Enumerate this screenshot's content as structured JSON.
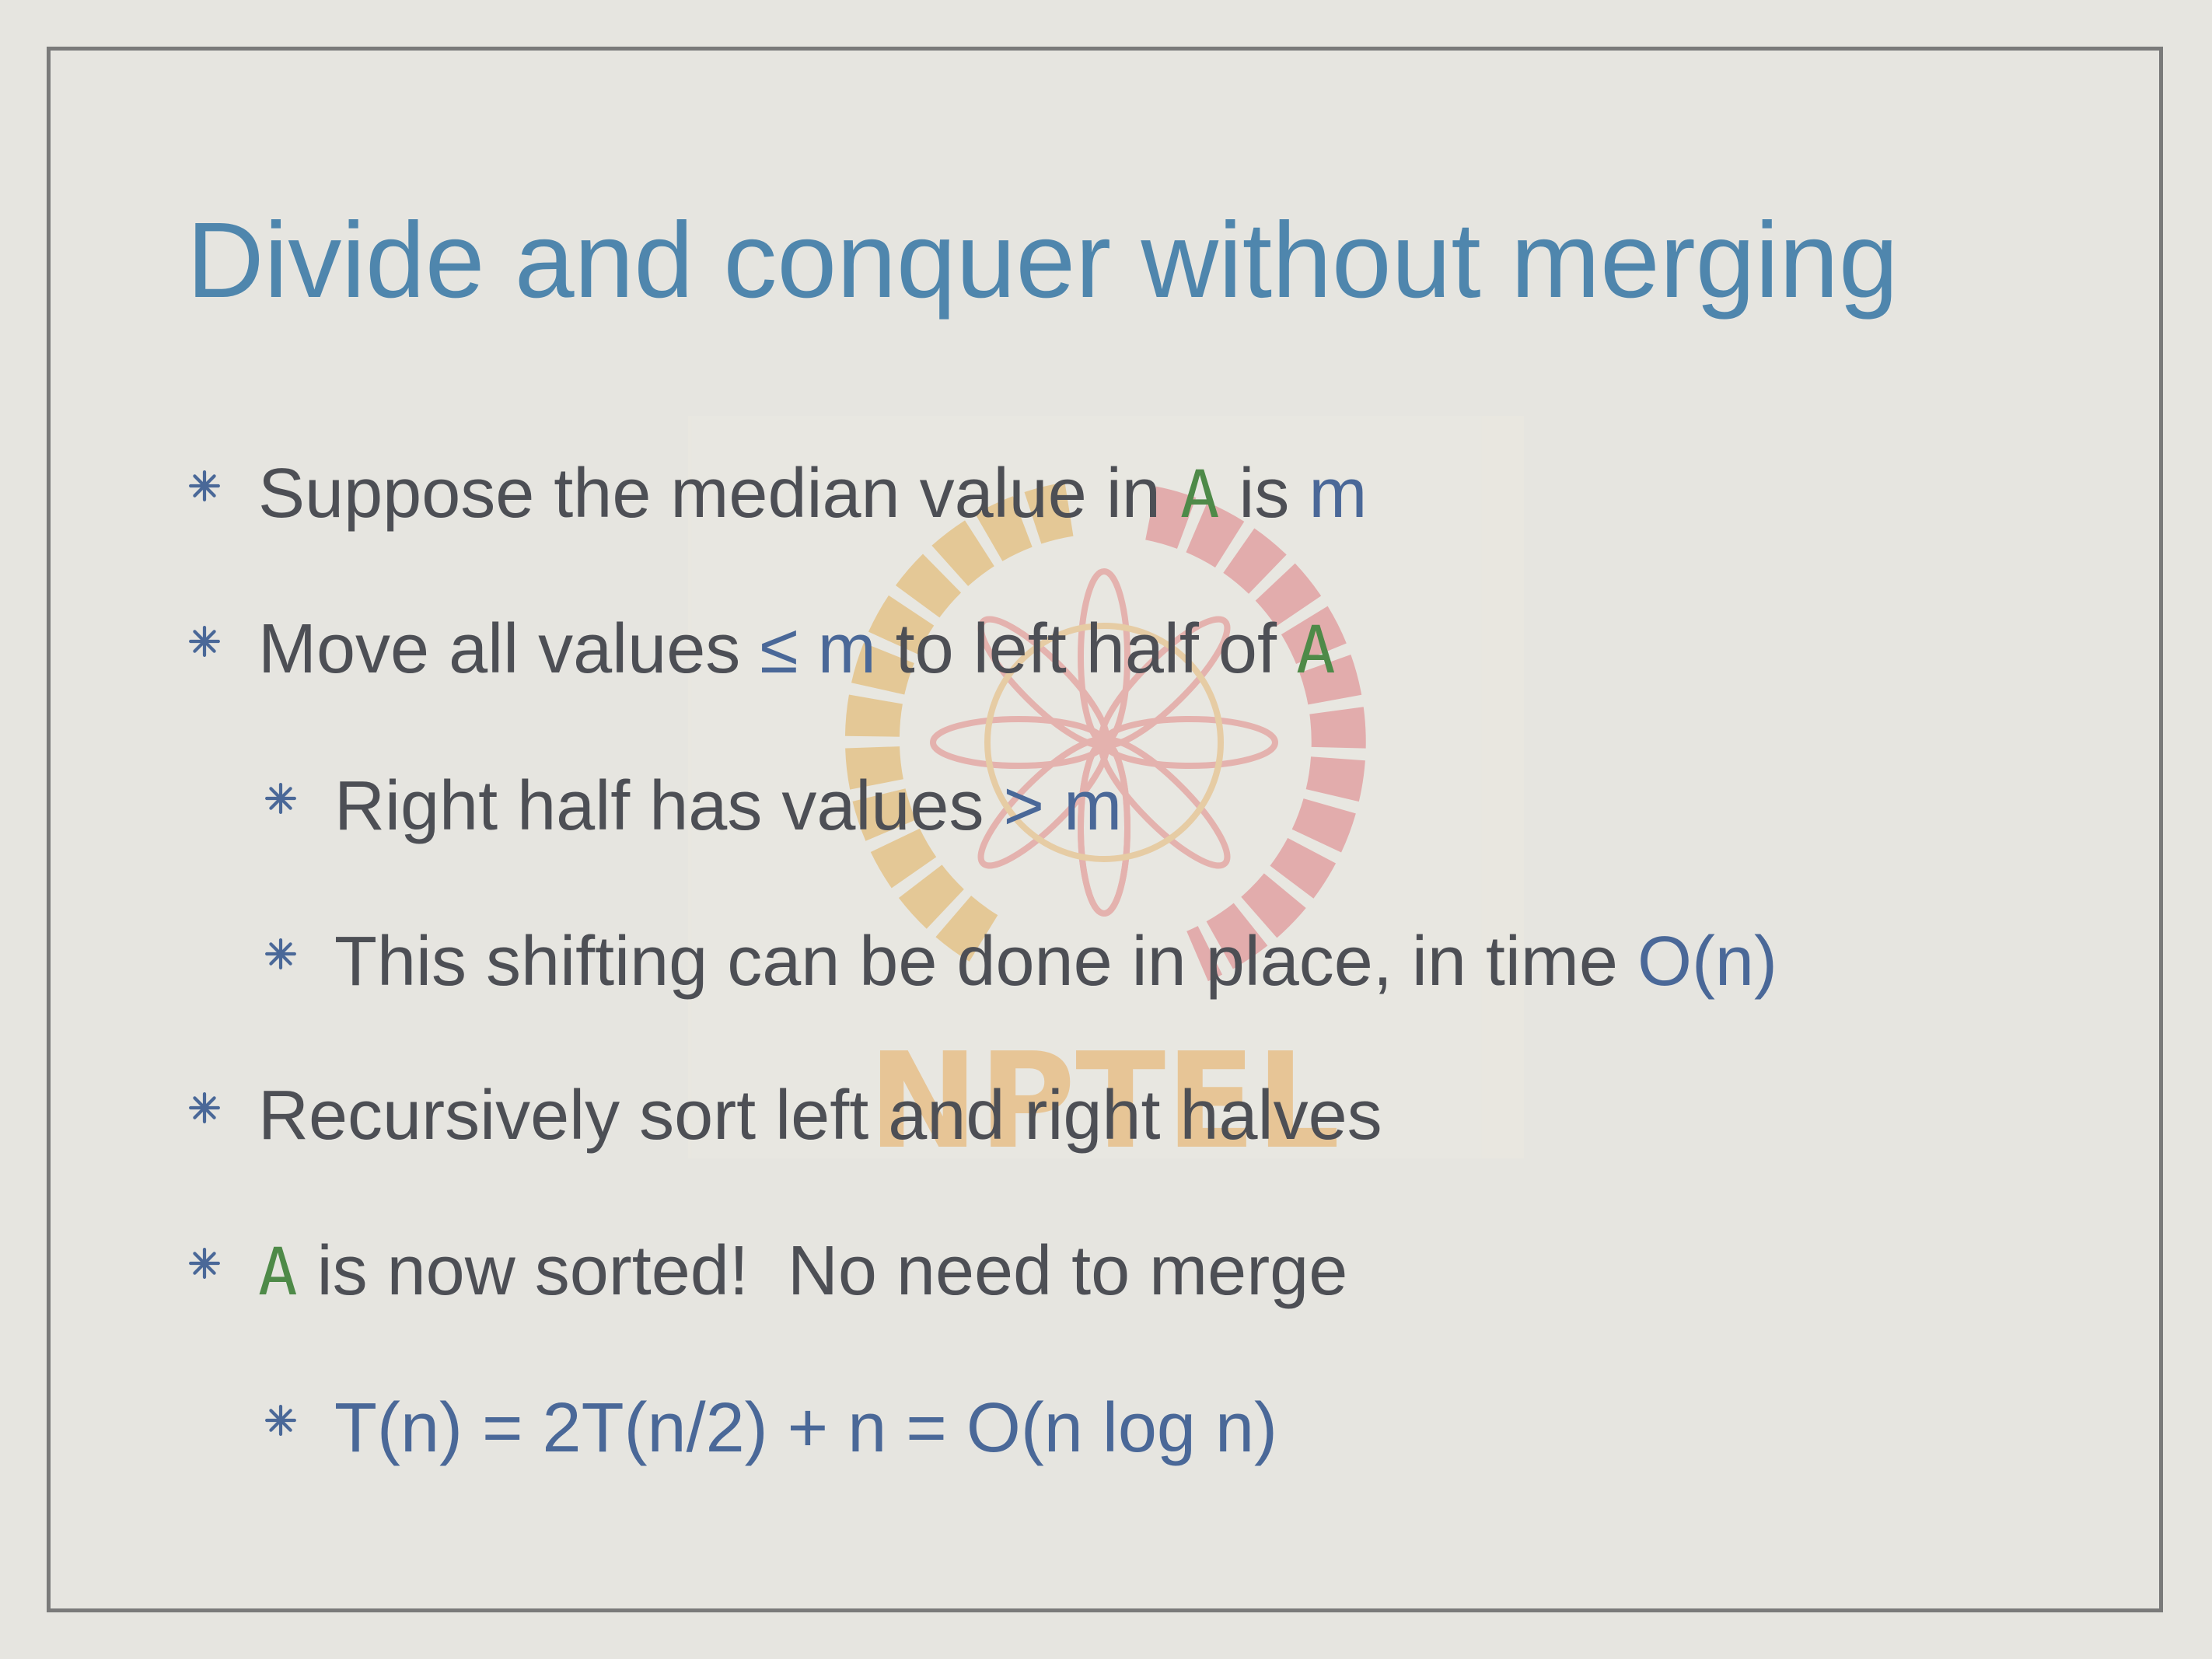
{
  "slide": {
    "title": "Divide and conquer without merging",
    "watermark_text": "NPTEL",
    "bullet_icon": "asterisk-bullet-icon",
    "colors": {
      "title": "#4f86ad",
      "body_text": "#4d4f55",
      "array_name": "#4e8a48",
      "math": "#4a6898",
      "frame": "#7a7a7a",
      "background": "#e6e5e0"
    },
    "bullets": [
      {
        "level": 1,
        "parts": [
          "Suppose the median value in ",
          "A",
          " is ",
          "m"
        ]
      },
      {
        "level": 1,
        "parts": [
          "Move all values ",
          "≤ m",
          " to left half of ",
          "A"
        ]
      },
      {
        "level": 2,
        "parts": [
          "Right half has values ",
          "> m"
        ]
      },
      {
        "level": 2,
        "parts": [
          "This shifting can be done in place, in time ",
          "O(n)"
        ]
      },
      {
        "level": 1,
        "parts": [
          "Recursively sort left and right halves"
        ]
      },
      {
        "level": 1,
        "parts": [
          "A",
          " is now sorted!  No need to merge"
        ]
      },
      {
        "level": 2,
        "parts": [
          "T(n) = 2T(n/2) + n = O(n log n)"
        ]
      }
    ]
  }
}
